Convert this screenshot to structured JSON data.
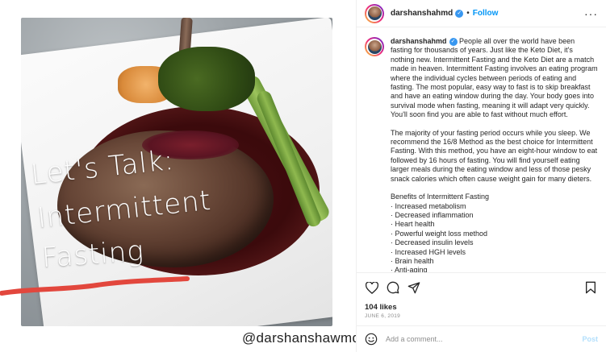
{
  "post": {
    "overlay_lines": [
      "Let's Talk:",
      "Intermittent",
      "Fasting"
    ],
    "handle": "@darshanshawmd"
  },
  "header": {
    "username": "darshanshahmd",
    "separator": "•",
    "follow_label": "Follow",
    "more_label": "···"
  },
  "caption": {
    "username": "darshanshahmd",
    "paragraphs": [
      "People all over the world have been fasting for thousands of years. Just like the Keto Diet, it's nothing new. Intermittent Fasting and the Keto Diet are a match made in heaven. Intermittent Fasting involves an eating program where the individual cycles between periods of eating and fasting. The most popular, easy way to fast is to skip breakfast and have an eating window during the day. Your body goes into survival mode when fasting, meaning it will adapt very quickly. You'll soon find you are able to fast without much effort.",
      "The majority of your fasting period occurs while you sleep. We recommend the 16/8 Method as the best choice for Intermittent Fasting. With this method, you have an eight-hour window to eat followed by 16 hours of fasting. You will find yourself eating larger meals during the eating window and less of those pesky snack calories which often cause weight gain for many dieters."
    ],
    "benefits_title": "Benefits of Intermittent Fasting",
    "benefits": [
      "· Increased metabolism",
      "· Decreased inflammation",
      "· Heart health",
      "· Powerful weight loss method",
      "· Decreased insulin levels",
      "· Increased HGH levels",
      "· Brain health",
      "· Anti-aging"
    ]
  },
  "stats": {
    "likes": "104 likes",
    "date": "JUNE 6, 2019"
  },
  "comment": {
    "placeholder": "Add a comment...",
    "post_label": "Post"
  },
  "icons": {
    "like": "heart-icon",
    "comment": "comment-icon",
    "share": "share-icon",
    "save": "bookmark-icon",
    "emoji": "emoji-icon",
    "verified": "verified-badge-icon"
  },
  "colors": {
    "accent": "#0095f6",
    "verified": "#3897f0",
    "muted": "#8e8e8e",
    "post_disabled": "#b2dffc"
  }
}
